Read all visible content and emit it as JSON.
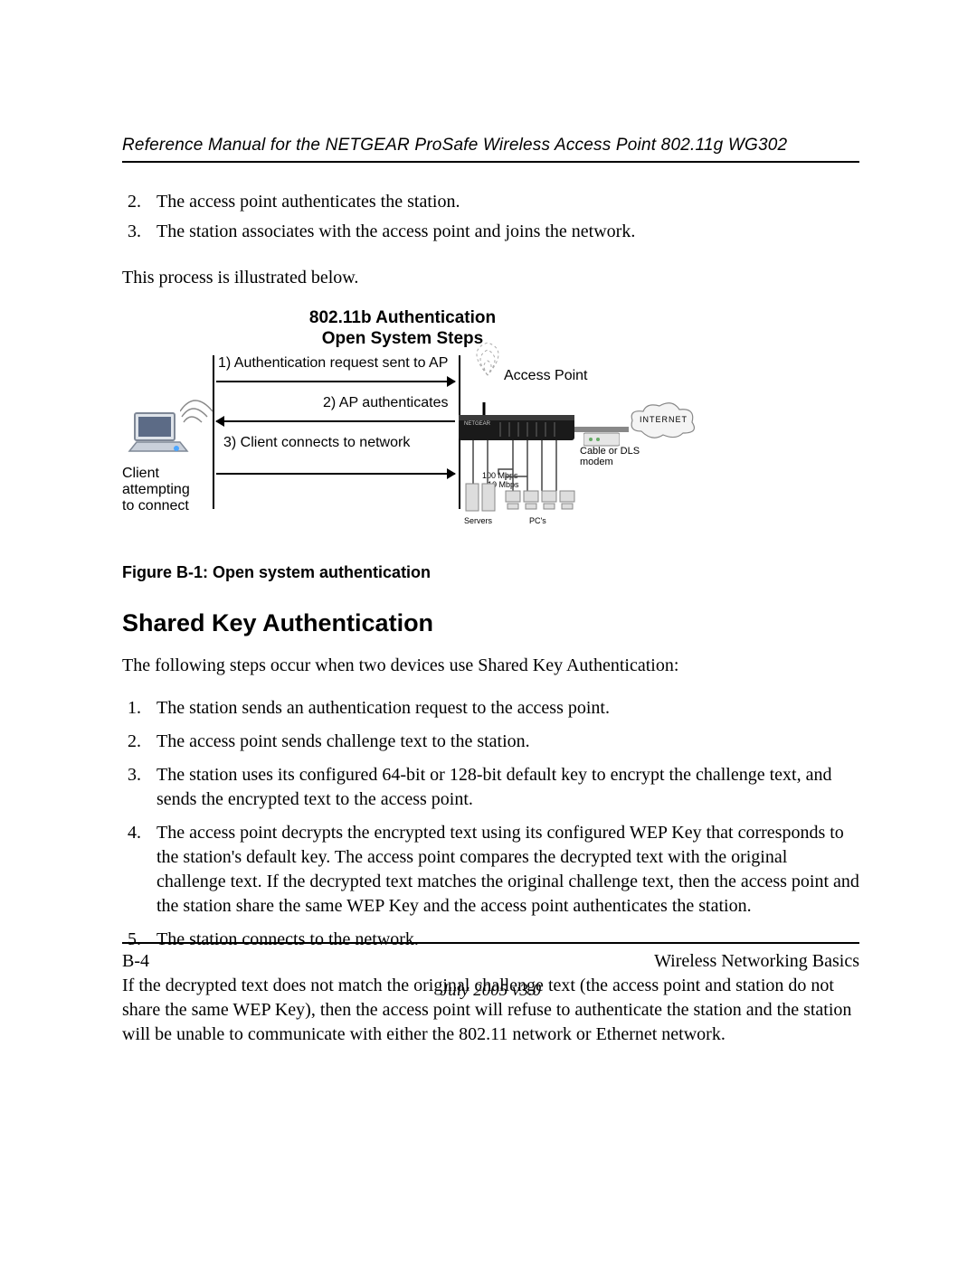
{
  "header": {
    "running_title": "Reference Manual for the NETGEAR ProSafe Wireless Access Point 802.11g WG302"
  },
  "top_list": {
    "items": [
      {
        "n": "2.",
        "text": "The access point authenticates the station."
      },
      {
        "n": "3.",
        "text": "The station associates with the access point and joins the network."
      }
    ]
  },
  "lead_para": "This process is illustrated below.",
  "diagram": {
    "title_line1": "802.11b Authentication",
    "title_line2": "Open System Steps",
    "client_label": "Client attempting to connect",
    "ap_label": "Access Point",
    "step1": "1) Authentication request sent to AP",
    "step2": "2) AP authenticates",
    "step3": "3) Client connects to network",
    "modem_label": "Cable or DLS modem",
    "internet_label": "INTERNET",
    "speed1": "100 Mbps",
    "speed2": "10 Mbps",
    "servers_label": "Servers",
    "pcs_label": "PC's"
  },
  "figure_caption": "Figure B-1:  Open system authentication",
  "section_heading": "Shared Key Authentication",
  "intro_para": "The following steps occur when two devices use Shared Key Authentication:",
  "steps": [
    {
      "n": "1.",
      "text": "The station sends an authentication request to the access point."
    },
    {
      "n": "2.",
      "text": "The access point sends challenge text to the station."
    },
    {
      "n": "3.",
      "text": "The station uses its configured 64-bit or 128-bit default key to encrypt the challenge text, and sends the encrypted text to the access point."
    },
    {
      "n": "4.",
      "text": "The access point decrypts the encrypted text using its configured WEP Key that corresponds to the station's default key. The access point compares the decrypted text with the original challenge text. If the decrypted text matches the original challenge text, then the access point and the station share the same WEP Key and the access point authenticates the station."
    },
    {
      "n": "5.",
      "text": "The station connects to the network."
    }
  ],
  "closing_para": "If the decrypted text does not match the original challenge text (the access point and station do not share the same WEP Key), then the access point will refuse to authenticate the station and the station will be unable to communicate with either the 802.11 network or Ethernet network.",
  "footer": {
    "page_number": "B-4",
    "section_title": "Wireless Networking Basics",
    "version": "July 2005 v3.0"
  }
}
